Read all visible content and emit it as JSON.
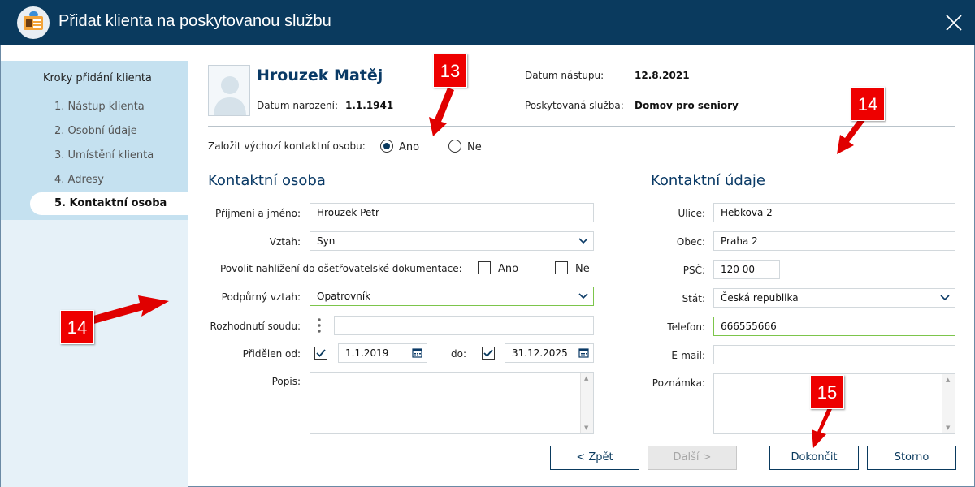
{
  "window": {
    "title": "Přidat klienta na poskytovanou službu"
  },
  "steps": {
    "title": "Kroky přidání klienta",
    "items": [
      "1. Nástup klienta",
      "2. Osobní údaje",
      "3. Umístění klienta",
      "4. Adresy"
    ],
    "active": "5. Kontaktní osoba"
  },
  "client": {
    "name": "Hrouzek Matěj",
    "birth_label": "Datum narození:",
    "birth_value": "1.1.1941",
    "start_label": "Datum nástupu:",
    "start_value": "12.8.2021",
    "service_label": "Poskytovaná služba:",
    "service_value": "Domov pro seniory"
  },
  "default_contact": {
    "label": "Založit výchozí kontaktní osobu:",
    "yes": "Ano",
    "no": "Ne",
    "selected": "Ano"
  },
  "contact_person": {
    "title": "Kontaktní osoba",
    "name_label": "Příjmení a jméno:",
    "name_value": "Hrouzek Petr",
    "relation_label": "Vztah:",
    "relation_value": "Syn",
    "allow_label": "Povolit nahlížení do ošetřovatelské dokumentace:",
    "allow_yes": "Ano",
    "allow_no": "Ne",
    "support_label": "Podpůrný vztah:",
    "support_value": "Opatrovník",
    "court_label": "Rozhodnutí soudu:",
    "court_value": "",
    "assigned_label": "Přidělen od:",
    "assigned_from": "1.1.2019",
    "to_label": "do:",
    "assigned_to": "31.12.2025",
    "note_label": "Popis:"
  },
  "contact_details": {
    "title": "Kontaktní údaje",
    "street_label": "Ulice:",
    "street_value": "Hebkova 2",
    "city_label": "Obec:",
    "city_value": "Praha 2",
    "zip_label": "PSČ:",
    "zip_value": "120 00",
    "country_label": "Stát:",
    "country_value": "Česká republika",
    "phone_label": "Telefon:",
    "phone_value": "666555666",
    "email_label": "E-mail:",
    "email_value": "",
    "note_label": "Poznámka:"
  },
  "buttons": {
    "back": "< Zpět",
    "next": "Další >",
    "finish": "Dokončit",
    "cancel": "Storno"
  },
  "annotations": [
    "13",
    "14",
    "14",
    "15"
  ],
  "colors": {
    "titlebar": "#0a3a5e",
    "accent": "#0a3a66",
    "badge": "#e00000",
    "valid_border": "#7cc54b"
  },
  "icons": [
    "client-card-icon",
    "close-icon",
    "user-silhouette-icon",
    "chevron-down-icon",
    "calendar-icon",
    "kebab-icon",
    "checkmark-icon"
  ]
}
